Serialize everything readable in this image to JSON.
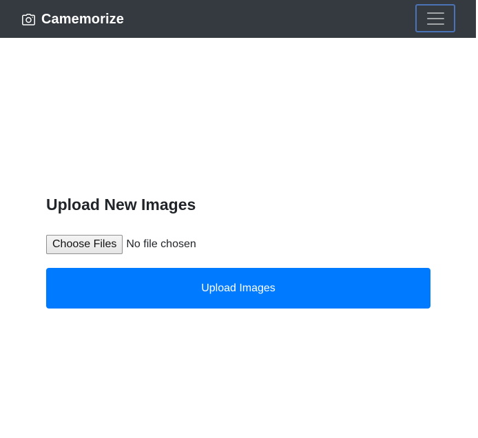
{
  "navbar": {
    "brand": "Camemorize",
    "brand_icon": "camera-icon",
    "toggler_icon": "hamburger-menu-icon",
    "background": "#343a40",
    "toggler_border": "#4a73b8"
  },
  "main": {
    "title": "Upload New Images",
    "file_input": {
      "button_label": "Choose Files",
      "status": "No file chosen"
    },
    "upload_button": {
      "label": "Upload Images",
      "color": "#007bff"
    }
  }
}
